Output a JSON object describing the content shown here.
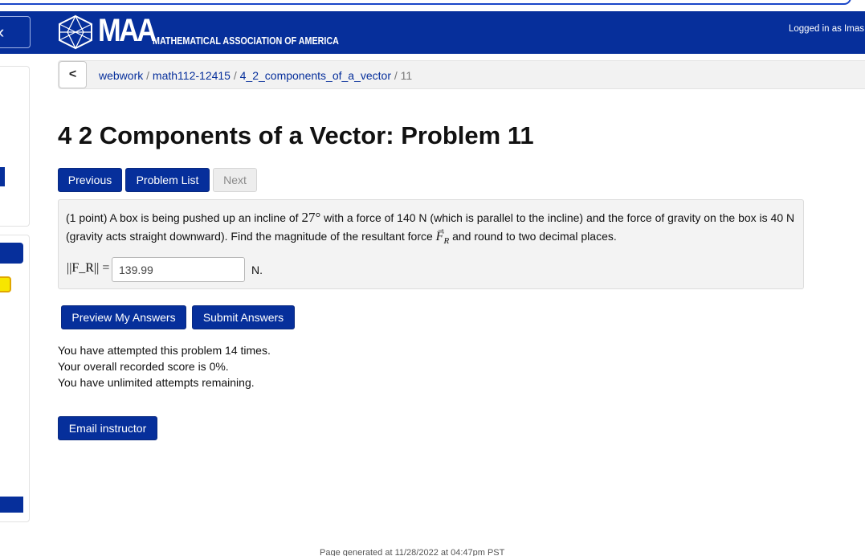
{
  "header": {
    "logo_text": "MAA",
    "org_name": "MATHEMATICAL ASSOCIATION OF AMERICA",
    "login_text": "Logged in as Imas",
    "colors": {
      "brand": "#062f9b"
    }
  },
  "breadcrumb": {
    "back_icon": "chevron-left-icon",
    "items": [
      "webwork",
      "math112-12415",
      "4_2_components_of_a_vector"
    ],
    "current": "11",
    "separator": "/"
  },
  "page": {
    "title": "4 2 Components of a Vector: Problem 11"
  },
  "nav": {
    "previous": "Previous",
    "problem_list": "Problem List",
    "next": "Next"
  },
  "problem": {
    "points": "(1 point)",
    "text_part1": "A box is being pushed up an incline of",
    "angle": "27°",
    "text_part2": "with a force of 140 N (which is parallel to the incline) and the force of gravity on the box is 40 N (gravity acts straight downward). Find the magnitude of the resultant force",
    "vector_symbol": "F",
    "vector_subscript": "R",
    "text_part3": "and round to two decimal places.",
    "answer_label": "||F_R|| =",
    "answer_value": "139.99",
    "unit": "N."
  },
  "actions": {
    "preview": "Preview My Answers",
    "submit": "Submit Answers",
    "email": "Email instructor"
  },
  "status": {
    "attempts": "You have attempted this problem 14 times.",
    "score": "Your overall recorded score is 0%.",
    "remaining": "You have unlimited attempts remaining."
  },
  "footer": {
    "generated": "Page generated at 11/28/2022 at 04:47pm PST"
  }
}
